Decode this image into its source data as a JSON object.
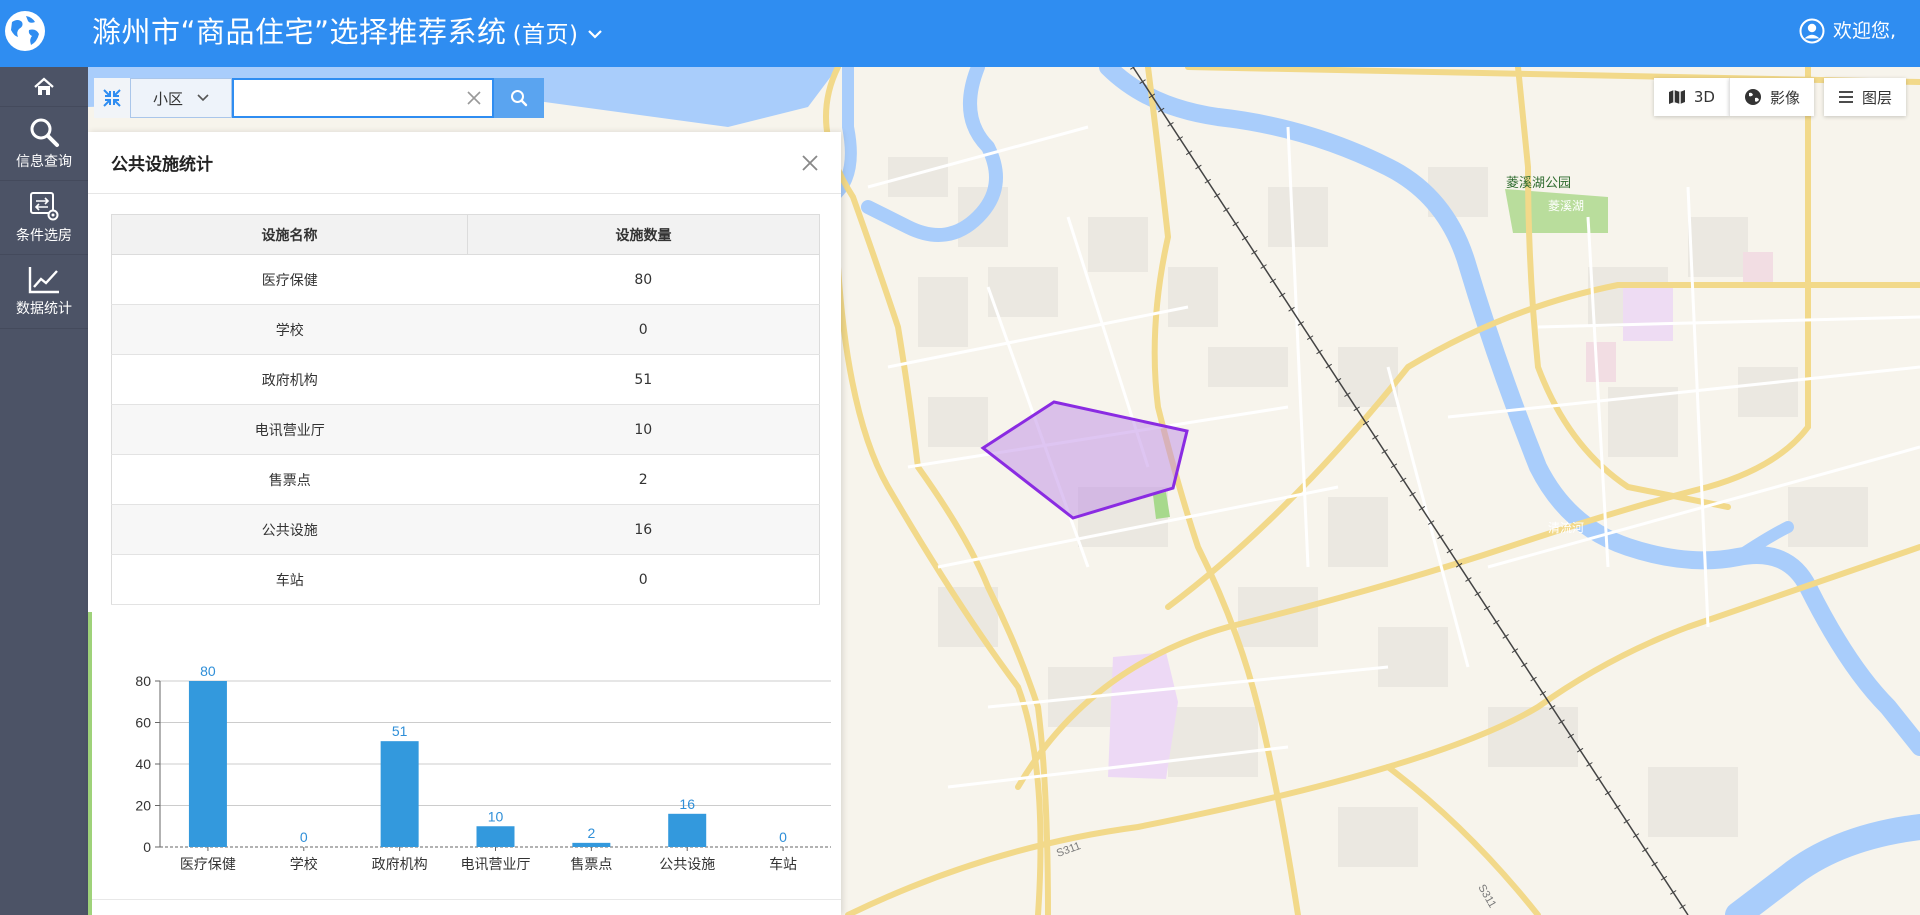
{
  "header": {
    "title": "滁州市“商品住宅”选择推荐系统",
    "subtitle": "(首页)",
    "welcome": "欢迎您,"
  },
  "nav": {
    "items": [
      {
        "label": "信息查询"
      },
      {
        "label": "条件选房"
      },
      {
        "label": "数据统计"
      }
    ]
  },
  "search": {
    "select_value": "小区",
    "input_value": "",
    "placeholder": ""
  },
  "map_tools": {
    "three_d": "3D",
    "imagery": "影像",
    "layers": "图层"
  },
  "map_labels": {
    "park": "菱溪湖公园",
    "lake": "菱溪湖",
    "river": "清流河",
    "road1": "S311",
    "road2": "S311"
  },
  "panel": {
    "title": "公共设施统计",
    "columns": [
      "设施名称",
      "设施数量"
    ],
    "rows": [
      {
        "name": "医疗保健",
        "count": "80"
      },
      {
        "name": "学校",
        "count": "0"
      },
      {
        "name": "政府机构",
        "count": "51"
      },
      {
        "name": "电讯营业厅",
        "count": "10"
      },
      {
        "name": "售票点",
        "count": "2"
      },
      {
        "name": "公共设施",
        "count": "16"
      },
      {
        "name": "车站",
        "count": "0"
      }
    ]
  },
  "chart_data": {
    "type": "bar",
    "categories": [
      "医疗保健",
      "学校",
      "政府机构",
      "电讯营业厅",
      "售票点",
      "公共设施",
      "车站"
    ],
    "values": [
      80,
      0,
      51,
      10,
      2,
      16,
      0
    ],
    "title": "",
    "xlabel": "",
    "ylabel": "",
    "ylim": [
      0,
      80
    ],
    "yticks": [
      0,
      20,
      40,
      60,
      80
    ],
    "grid": true,
    "bar_color": "#3399dd"
  },
  "colors": {
    "header": "#2f8df1",
    "nav": "#4c5366",
    "polygon": "#8a2be2"
  }
}
